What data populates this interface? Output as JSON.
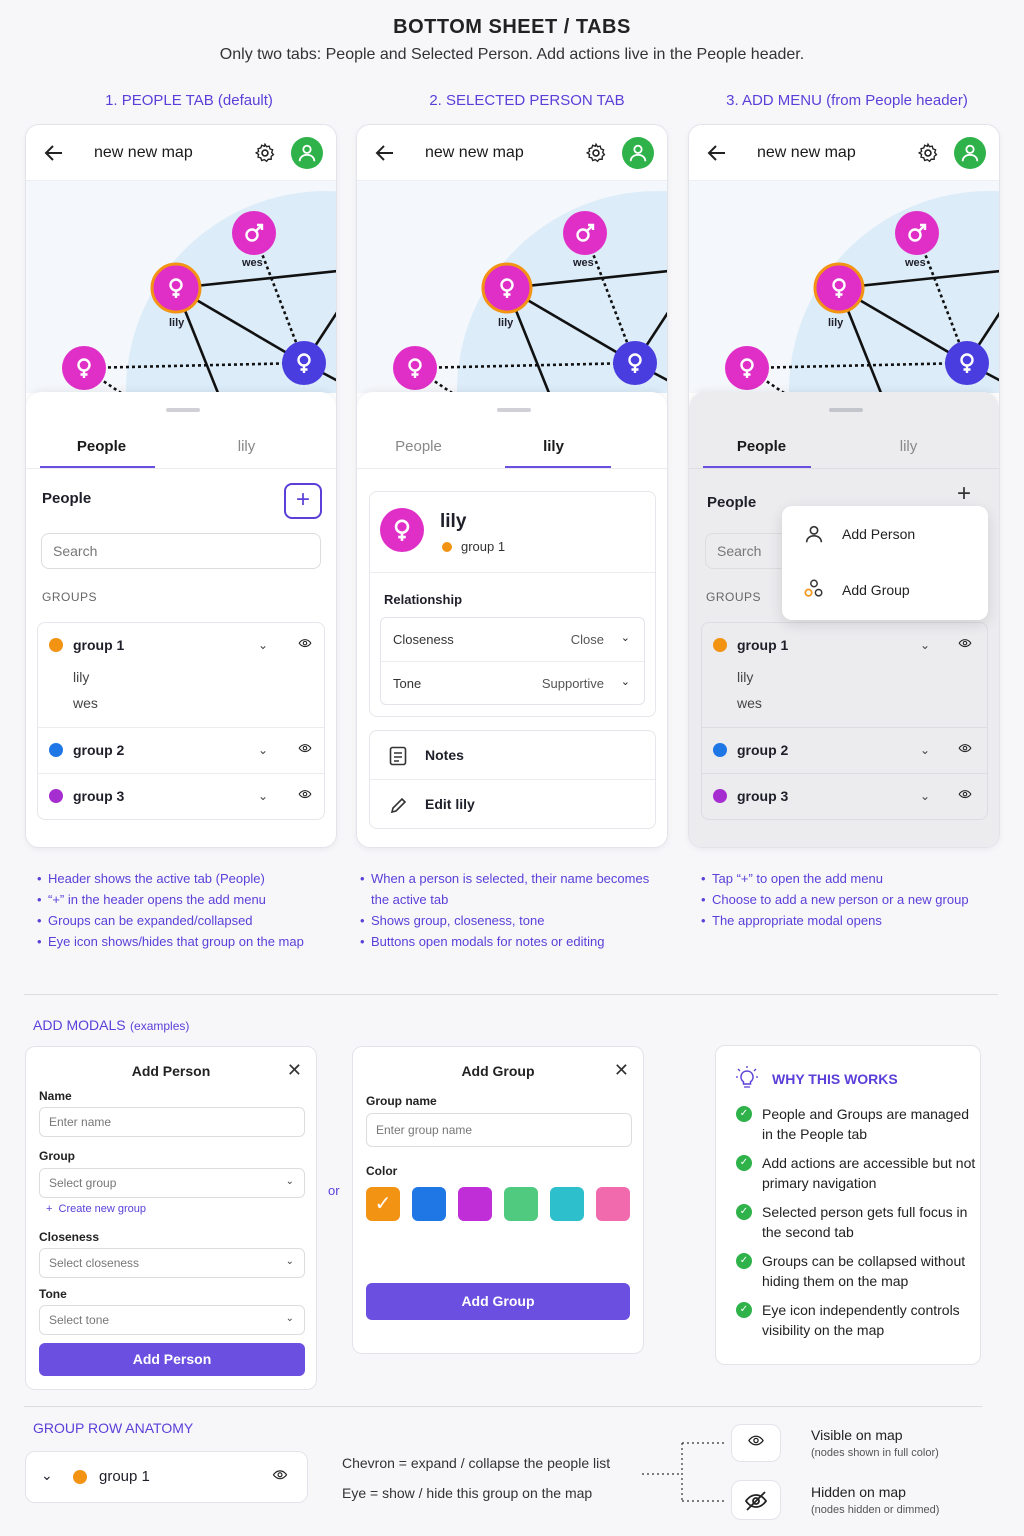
{
  "page": {
    "title": "BOTTOM SHEET / TABS",
    "subtitle": "Only two tabs: People and Selected Person. Add actions live in the People header."
  },
  "columns": [
    {
      "heading": "1. PEOPLE TAB (default)"
    },
    {
      "heading": "2. SELECTED PERSON TAB"
    },
    {
      "heading": "3. ADD MENU (from People header)"
    }
  ],
  "app": {
    "map_title": "new new map",
    "tabs": {
      "people": "People",
      "selected": "lily"
    },
    "node_labels": {
      "wes": "wes",
      "lily": "lily"
    }
  },
  "people_tab": {
    "section_label": "People",
    "add_symbol": "+",
    "search_placeholder": "Search",
    "groups_label": "GROUPS",
    "groups": [
      {
        "name": "group 1",
        "color": "#f39313",
        "members": [
          "lily",
          "wes"
        ]
      },
      {
        "name": "group 2",
        "color": "#1f77e6",
        "members": []
      },
      {
        "name": "group 3",
        "color": "#a52ed0",
        "members": []
      }
    ]
  },
  "selected_tab": {
    "name": "lily",
    "group": "group 1",
    "relationship_label": "Relationship",
    "closeness_label": "Closeness",
    "closeness_value": "Close",
    "tone_label": "Tone",
    "tone_value": "Supportive",
    "notes_label": "Notes",
    "edit_label": "Edit lily"
  },
  "add_menu": {
    "items": [
      "Add Person",
      "Add Group"
    ]
  },
  "notes": {
    "col1": [
      "Header shows the active tab (People)",
      "“+” in the header opens the add menu",
      "Groups can be expanded/collapsed",
      "Eye icon shows/hides that group on the map"
    ],
    "col2": [
      "When a person is selected, their name becomes the active tab",
      "Shows group, closeness, tone",
      "Buttons open modals for notes or editing"
    ],
    "col3": [
      "Tap “+” to open the add menu",
      "Choose to add a new person or a new group",
      "The appropriate modal opens"
    ]
  },
  "add_modals": {
    "heading": "ADD MODALS",
    "heading_suffix": "(examples)",
    "or_label": "or",
    "person": {
      "title": "Add Person",
      "name_label": "Name",
      "name_placeholder": "Enter name",
      "group_label": "Group",
      "group_placeholder": "Select group",
      "create_group_link": "Create new group",
      "closeness_label": "Closeness",
      "closeness_placeholder": "Select closeness",
      "tone_label": "Tone",
      "tone_placeholder": "Select tone",
      "submit": "Add Person"
    },
    "group": {
      "title": "Add Group",
      "name_label": "Group name",
      "name_placeholder": "Enter group name",
      "color_label": "Color",
      "colors": [
        "#f39313",
        "#1f77e6",
        "#c02ed8",
        "#4fca7e",
        "#2ebfcc",
        "#f06aad"
      ],
      "submit": "Add Group"
    }
  },
  "why": {
    "heading": "WHY THIS WORKS",
    "items": [
      "People and Groups are managed in the People tab",
      "Add actions are accessible but not primary navigation",
      "Selected person gets full focus in the second tab",
      "Groups can be collapsed without hiding them on the map",
      "Eye icon independently controls visibility on the map"
    ]
  },
  "anatomy": {
    "heading": "GROUP ROW ANATOMY",
    "group_name": "group 1",
    "chevron_text": "Chevron = expand / collapse the people list",
    "eye_text": "Eye = show / hide this group on the map",
    "visible_title": "Visible on map",
    "visible_sub": "(nodes shown in full color)",
    "hidden_title": "Hidden on map",
    "hidden_sub": "(nodes hidden or dimmed)"
  }
}
